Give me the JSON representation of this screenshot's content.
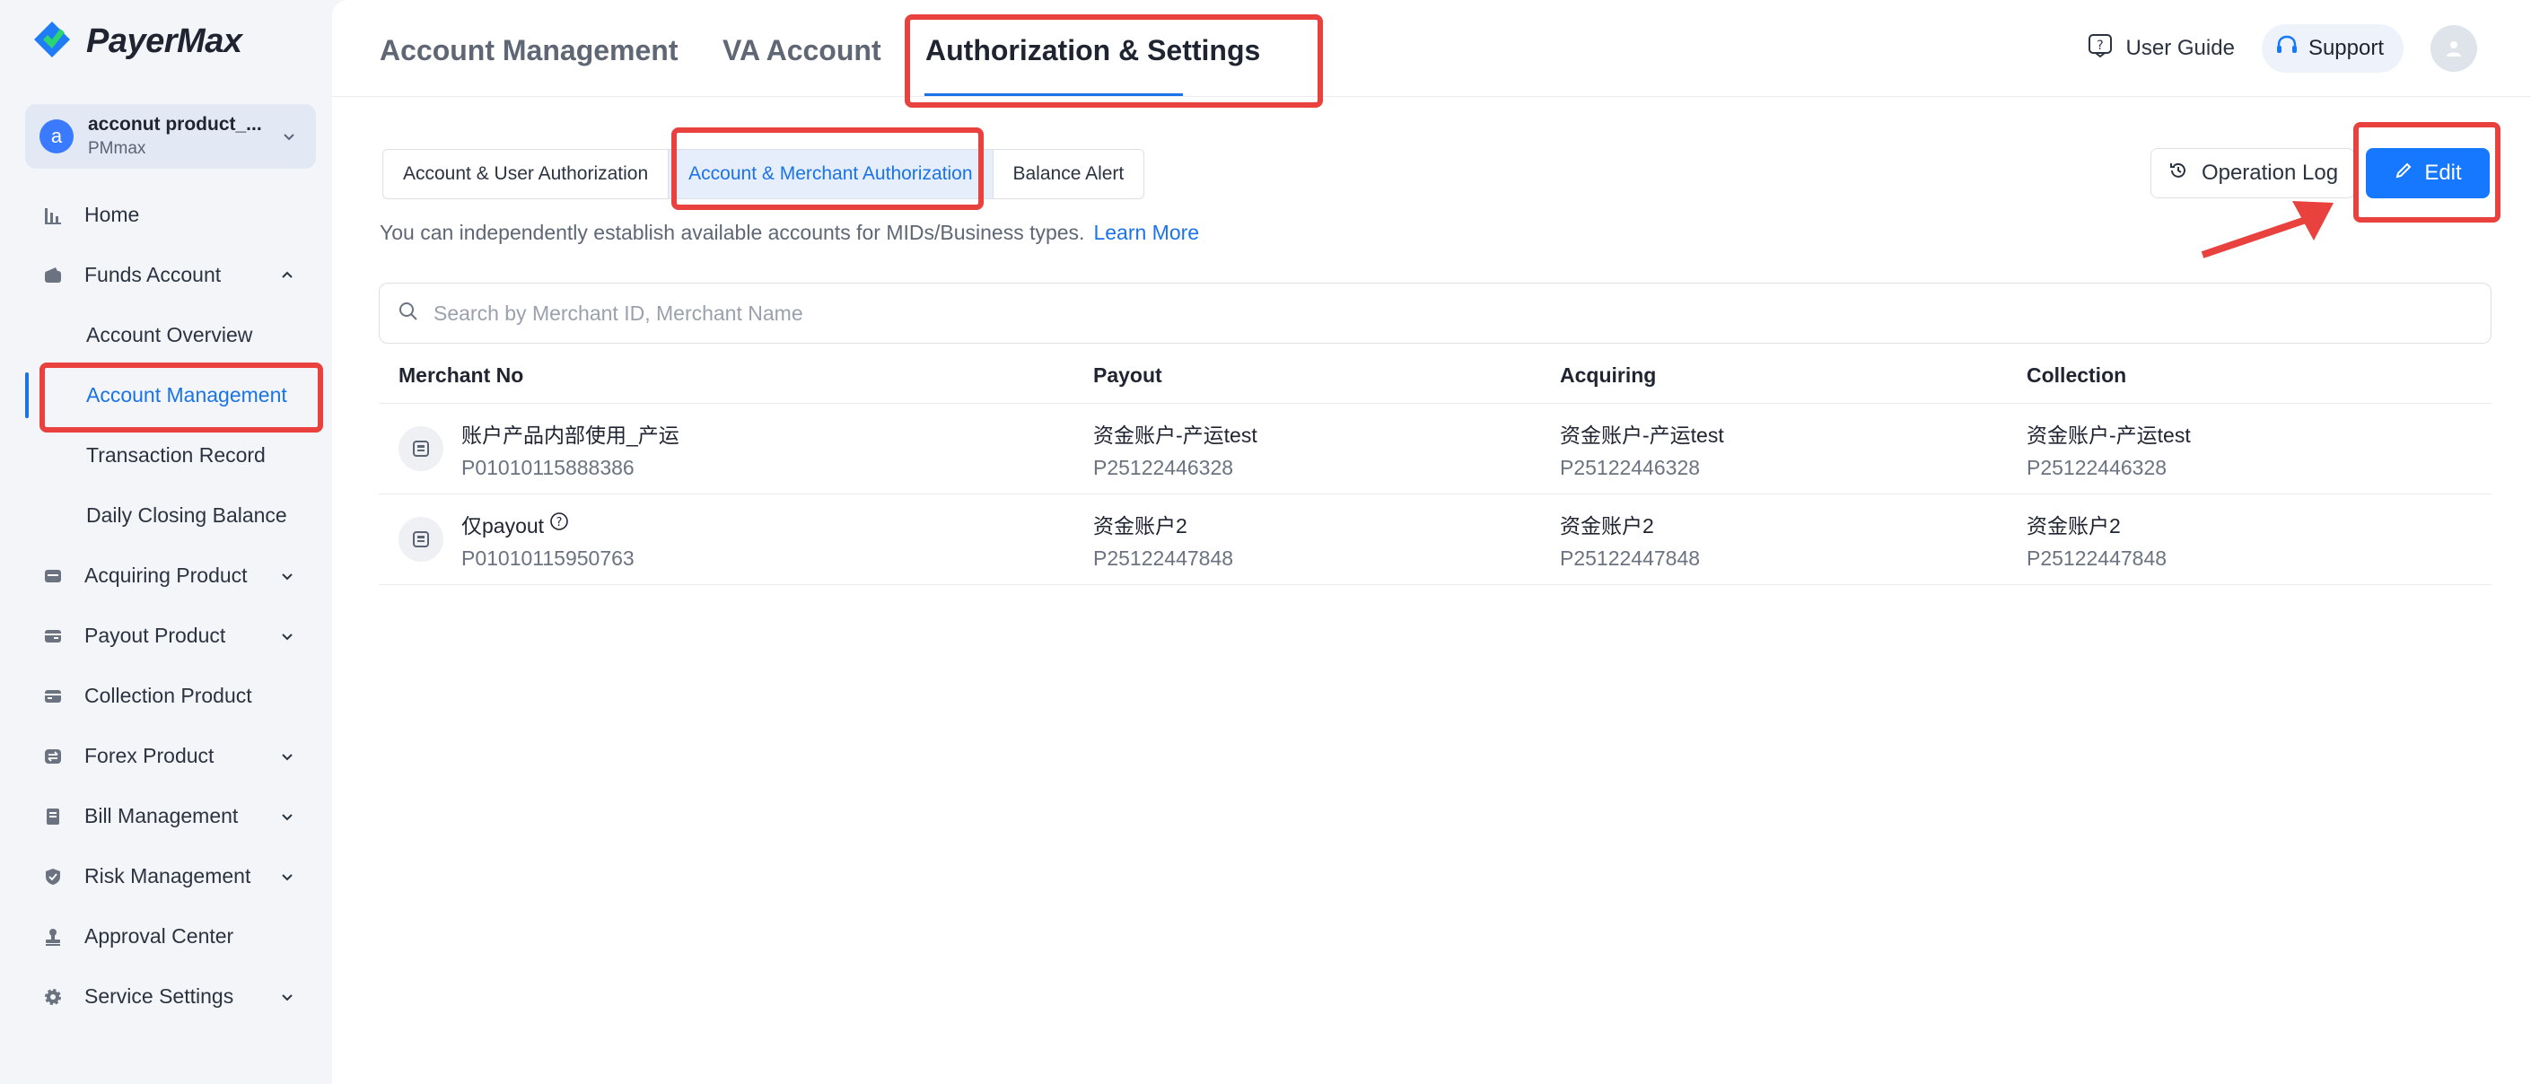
{
  "brand": {
    "name": "PayerMax"
  },
  "org": {
    "avatar_letter": "a",
    "name": "acconut product_...",
    "sub": "PMmax"
  },
  "sidebar": {
    "items": [
      {
        "label": "Home",
        "icon": "bar-chart-icon",
        "has_chevron": false
      },
      {
        "label": "Funds Account",
        "icon": "wallet-icon",
        "has_chevron": true,
        "expanded": true,
        "children": [
          {
            "label": "Account Overview"
          },
          {
            "label": "Account Management",
            "active": true
          },
          {
            "label": "Transaction Record"
          },
          {
            "label": "Daily Closing Balance"
          }
        ]
      },
      {
        "label": "Acquiring Product",
        "icon": "card-icon",
        "has_chevron": true
      },
      {
        "label": "Payout Product",
        "icon": "payout-icon",
        "has_chevron": true
      },
      {
        "label": "Collection Product",
        "icon": "collection-icon",
        "has_chevron": false
      },
      {
        "label": "Forex Product",
        "icon": "exchange-icon",
        "has_chevron": true
      },
      {
        "label": "Bill Management",
        "icon": "bill-icon",
        "has_chevron": true
      },
      {
        "label": "Risk Management",
        "icon": "shield-icon",
        "has_chevron": true
      },
      {
        "label": "Approval Center",
        "icon": "stamp-icon",
        "has_chevron": false
      },
      {
        "label": "Service Settings",
        "icon": "gear-icon",
        "has_chevron": true
      }
    ]
  },
  "header": {
    "tabs": [
      {
        "label": "Account Management"
      },
      {
        "label": "VA Account"
      },
      {
        "label": "Authorization & Settings",
        "active": true
      }
    ],
    "user_guide": "User Guide",
    "support": "Support"
  },
  "subtabs": [
    {
      "label": "Account & User Authorization"
    },
    {
      "label": "Account & Merchant Authorization",
      "active": true
    },
    {
      "label": "Balance Alert"
    }
  ],
  "description": {
    "text": "You can independently establish available accounts for MIDs/Business types.",
    "link": "Learn More"
  },
  "actions": {
    "operation_log": "Operation Log",
    "edit": "Edit"
  },
  "search": {
    "placeholder": "Search by Merchant ID, Merchant Name",
    "value": ""
  },
  "table": {
    "columns": [
      "Merchant No",
      "Payout",
      "Acquiring",
      "Collection"
    ],
    "rows": [
      {
        "name": "账户产品内部使用_产运",
        "id": "P01010115888386",
        "has_help": false,
        "payout": {
          "name": "资金账户-产运test",
          "id": "P25122446328"
        },
        "acquiring": {
          "name": "资金账户-产运test",
          "id": "P25122446328"
        },
        "collection": {
          "name": "资金账户-产运test",
          "id": "P25122446328"
        }
      },
      {
        "name": "仅payout",
        "id": "P01010115950763",
        "has_help": true,
        "payout": {
          "name": "资金账户2",
          "id": "P25122447848"
        },
        "acquiring": {
          "name": "资金账户2",
          "id": "P25122447848"
        },
        "collection": {
          "name": "资金账户2",
          "id": "P25122447848"
        }
      }
    ]
  },
  "colors": {
    "accent": "#1677ff",
    "annotation": "#e8413e"
  }
}
